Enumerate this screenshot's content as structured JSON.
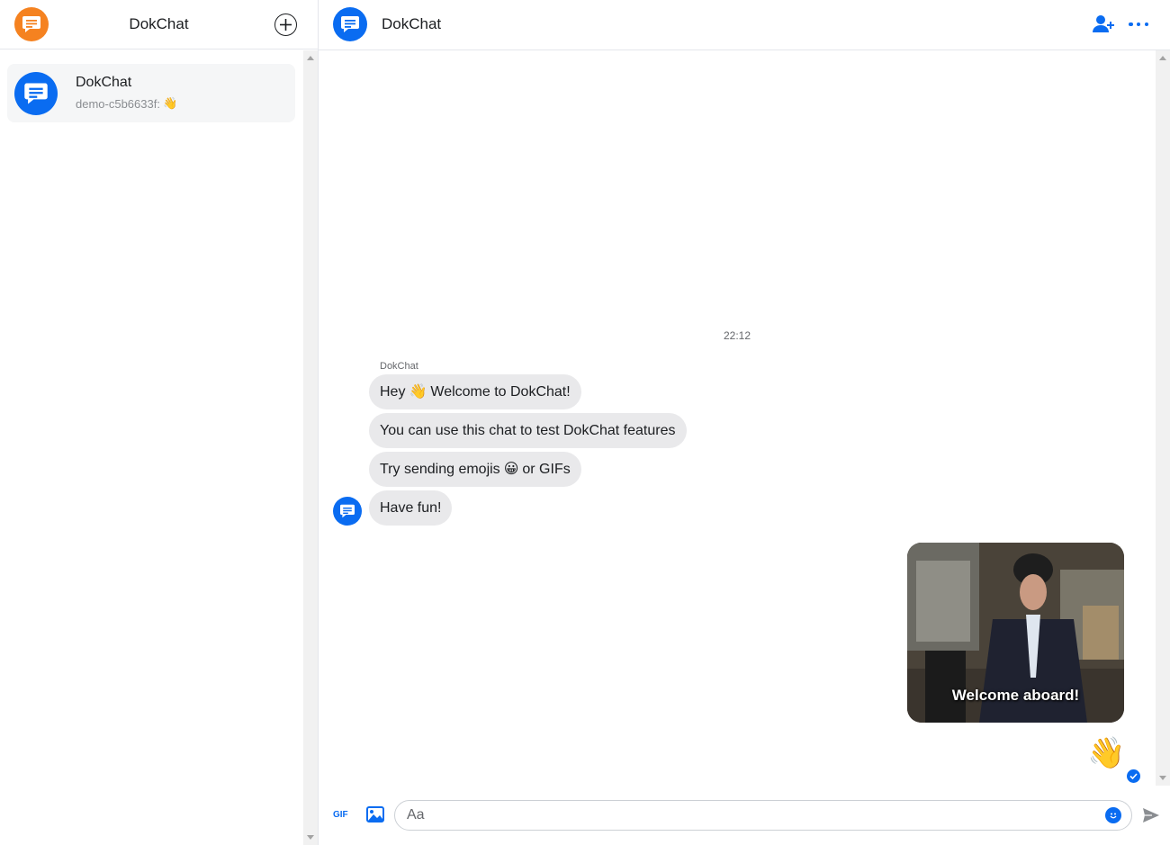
{
  "sidebar": {
    "title": "DokChat",
    "logo_icon": "chat-bubble-icon",
    "new_chat_icon": "plus-circle-icon",
    "conversations": [
      {
        "name": "DokChat",
        "preview": "demo-c5b6633f:",
        "preview_emoji": "👋"
      }
    ]
  },
  "chat": {
    "title": "DokChat",
    "add_user_icon": "add-user-icon",
    "more_icon": "more-dots-icon",
    "timestamp": "22:12",
    "sender": "DokChat",
    "messages": [
      {
        "before": "Hey",
        "emoji": "👋",
        "after": "Welcome to DokChat!"
      },
      {
        "before": "You can use this chat to test DokChat features",
        "emoji": "",
        "after": ""
      },
      {
        "before": "Try sending emojis",
        "emoji": "😀",
        "after": "or GIFs"
      },
      {
        "before": "Have fun!",
        "emoji": "",
        "after": ""
      }
    ],
    "sent_gif_caption": "Welcome aboard!",
    "sent_emoji": "👋"
  },
  "composer": {
    "gif_label": "GIF",
    "placeholder": "Aa"
  },
  "colors": {
    "brand_blue": "#0a6cf1",
    "logo_orange": "#f58220",
    "bubble_gray": "#e9e9eb"
  }
}
